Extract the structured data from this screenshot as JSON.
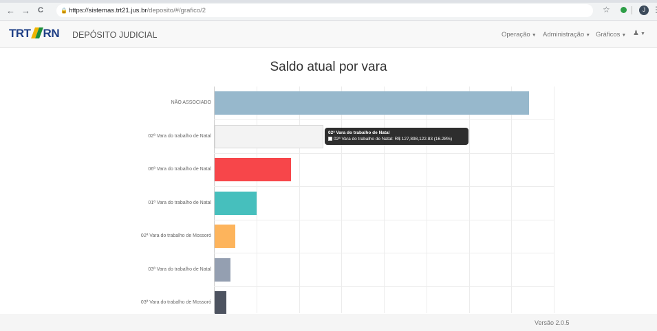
{
  "browser": {
    "back_icon": "←",
    "forward_icon": "→",
    "reload_icon": "C",
    "lock_icon": "🔒",
    "url_host": "https://sistemas.trt21.jus.br",
    "url_path": "/deposito/#/grafico/2",
    "star_icon": "☆",
    "profile_initial": "J",
    "menu_icon": "⋮"
  },
  "navbar": {
    "logo_part1": "TRT",
    "logo_part2": "21",
    "logo_part3": "RN",
    "brand": "DEPÓSITO JUDICIAL",
    "menu": [
      {
        "label": "Operação"
      },
      {
        "label": "Administração"
      },
      {
        "label": "Gráficos"
      }
    ],
    "user_icon": "👤"
  },
  "chart": {
    "title": "Saldo atual por vara",
    "tooltip": {
      "title": "02ª Vara do trabalho de Natal",
      "text": "02ª Vara do trabalho de Natal: R$ 127,898,122.83 (16.28%)"
    }
  },
  "chart_data": {
    "type": "bar",
    "orientation": "horizontal",
    "title": "Saldo atual por vara",
    "categories": [
      "NÃO ASSOCIADO",
      "02ª Vara do trabalho de Natal",
      "06ª Vara do trabalho de Natal",
      "01ª Vara do trabalho de Natal",
      "02ª Vara do trabalho de Mossoró",
      "03ª Vara do trabalho de Natal",
      "03ª Vara do trabalho de Mossoró"
    ],
    "values": [
      370,
      127.9,
      90,
      49,
      24,
      19,
      14
    ],
    "xlim": [
      0,
      400
    ],
    "colors": [
      "#97b8cc",
      "#f3f3f3",
      "#f7464a",
      "#46bfbd",
      "#fdb45c",
      "#949fb1",
      "#4d5360"
    ],
    "highlighted_index": 1,
    "grid": true,
    "legend": "none"
  },
  "footer": {
    "version": "Versão 2.0.5"
  }
}
